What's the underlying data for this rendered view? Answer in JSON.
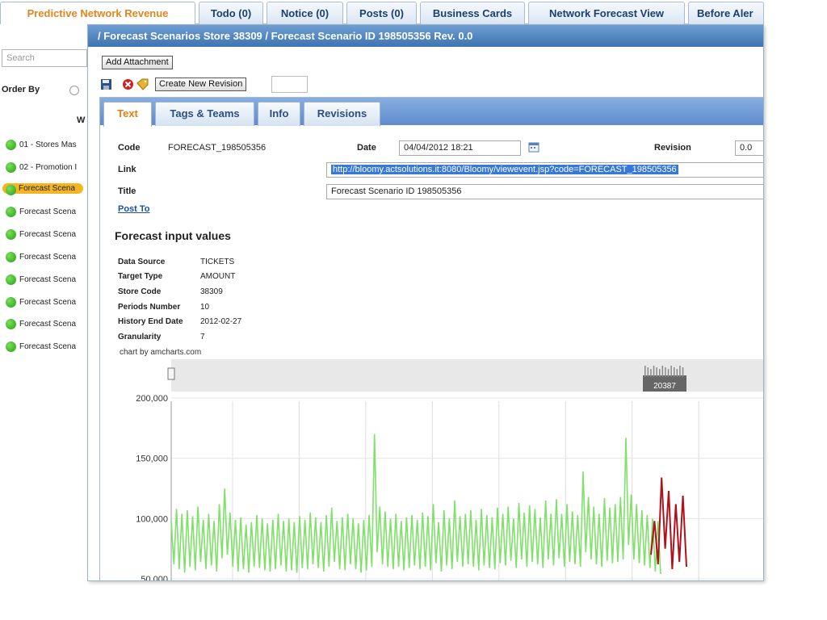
{
  "top_tabs": [
    {
      "label": "Predictive Network Revenue"
    },
    {
      "label": "Todo (0)"
    },
    {
      "label": "Notice (0)"
    },
    {
      "label": "Posts (0)"
    },
    {
      "label": "Business Cards"
    },
    {
      "label": "Network Forecast View"
    },
    {
      "label": "Before Aler"
    }
  ],
  "left": {
    "search_placeholder": "Search",
    "order_by": "Order By",
    "w_label": "W",
    "items": [
      {
        "label": "01 - Stores Mas"
      },
      {
        "label": "02 - Promotion I"
      },
      {
        "label": "Forecast Scena"
      },
      {
        "label": "Forecast Scena"
      },
      {
        "label": "Forecast Scena"
      },
      {
        "label": "Forecast Scena"
      },
      {
        "label": "Forecast Scena"
      },
      {
        "label": "Forecast Scena"
      },
      {
        "label": "Forecast Scena"
      },
      {
        "label": "Forecast Scena"
      }
    ]
  },
  "modal": {
    "title": "/ Forecast Scenarios Store 38309 / Forecast Scenario ID 198505356 Rev. 0.0",
    "add_attachment": "Add Attachment",
    "create_revision": "Create New Revision",
    "tabs": [
      {
        "label": "Text"
      },
      {
        "label": "Tags & Teams"
      },
      {
        "label": "Info"
      },
      {
        "label": "Revisions"
      }
    ],
    "fields": {
      "code_label": "Code",
      "code_value": "FORECAST_198505356",
      "date_label": "Date",
      "date_value": "04/04/2012 18:21",
      "revision_label": "Revision",
      "revision_value": "0.0",
      "link_label": "Link",
      "link_value": "http://bloomy.actsolutions.it:8080/Bloomy/viewevent.jsp?code=FORECAST_198505356",
      "title_label": "Title",
      "title_value": "Forecast Scenario ID 198505356",
      "post_to": "Post To"
    },
    "section_title": "Forecast input values",
    "inputs": [
      {
        "key": "Data Source",
        "value": "TICKETS"
      },
      {
        "key": "Target Type",
        "value": "AMOUNT"
      },
      {
        "key": "Store Code",
        "value": "38309"
      },
      {
        "key": "Periods Number",
        "value": "10"
      },
      {
        "key": "History End Date",
        "value": "2012-02-27"
      },
      {
        "key": "Granularity",
        "value": "7"
      }
    ],
    "chart_credit": "chart by amcharts.com"
  },
  "colors": {
    "history_series": "#7fe06a",
    "forecast_series": "#b0121c",
    "accent_orange": "#e0861d",
    "title_blue": "#3e74b3"
  },
  "chart_data": {
    "type": "line",
    "y_ticks": [
      "200,000",
      "150,000",
      "100,000",
      "50,000"
    ],
    "ylim": [
      50000,
      200000
    ],
    "scrollbar_label": "20387",
    "grid": true,
    "series": [
      {
        "values": [
          98000,
          62000,
          108000,
          58000,
          104000,
          55000,
          107000,
          60000,
          102000,
          57000,
          110000,
          64000,
          99000,
          58000,
          104000,
          61000,
          98000,
          56000,
          112000,
          67000,
          125000,
          70000,
          105000,
          60000,
          99000,
          56000,
          101000,
          58000,
          95000,
          55000,
          97000,
          60000,
          103000,
          59000,
          100000,
          57000,
          96000,
          56000,
          99000,
          58000,
          104000,
          61000,
          98000,
          56000,
          100000,
          57000,
          97000,
          55000,
          102000,
          59000,
          99000,
          58000,
          105000,
          62000,
          101000,
          59000,
          97000,
          56000,
          103000,
          60000,
          109000,
          64000,
          98000,
          58000,
          101000,
          57000,
          104000,
          62000,
          100000,
          58000,
          96000,
          55000,
          99000,
          57000,
          103000,
          60000,
          170000,
          72000,
          110000,
          62000,
          106000,
          60000,
          100000,
          58000,
          104000,
          60000,
          98000,
          57000,
          101000,
          59000,
          103000,
          61000,
          99000,
          58000,
          105000,
          60000,
          102000,
          57000,
          112000,
          63000,
          97000,
          56000,
          107000,
          61000,
          100000,
          58000,
          115000,
          64000,
          102000,
          60000,
          104000,
          62000,
          107000,
          60000,
          99000,
          57000,
          108000,
          61000,
          103000,
          59000,
          101000,
          58000,
          109000,
          63000,
          104000,
          61000,
          110000,
          65000,
          100000,
          59000,
          113000,
          66000,
          105000,
          60000,
          111000,
          64000,
          108000,
          62000,
          101000,
          59000,
          115000,
          66000,
          104000,
          61000,
          116000,
          67000,
          104000,
          60000,
          112000,
          64000,
          106000,
          62000,
          103000,
          60000,
          139000,
          72000,
          118000,
          66000,
          110000,
          62000,
          104000,
          60000,
          117000,
          65000,
          109000,
          63000,
          112000,
          64000,
          118000,
          66000,
          167000,
          78000,
          120000,
          66000,
          112000,
          63000,
          107000,
          61000,
          103000,
          59000,
          100000,
          56000,
          98000,
          54000
        ]
      },
      {
        "values": [
          70000,
          98000,
          62000,
          134000,
          75000,
          123000,
          58000,
          112000,
          64000,
          119000,
          60000
        ]
      }
    ]
  }
}
